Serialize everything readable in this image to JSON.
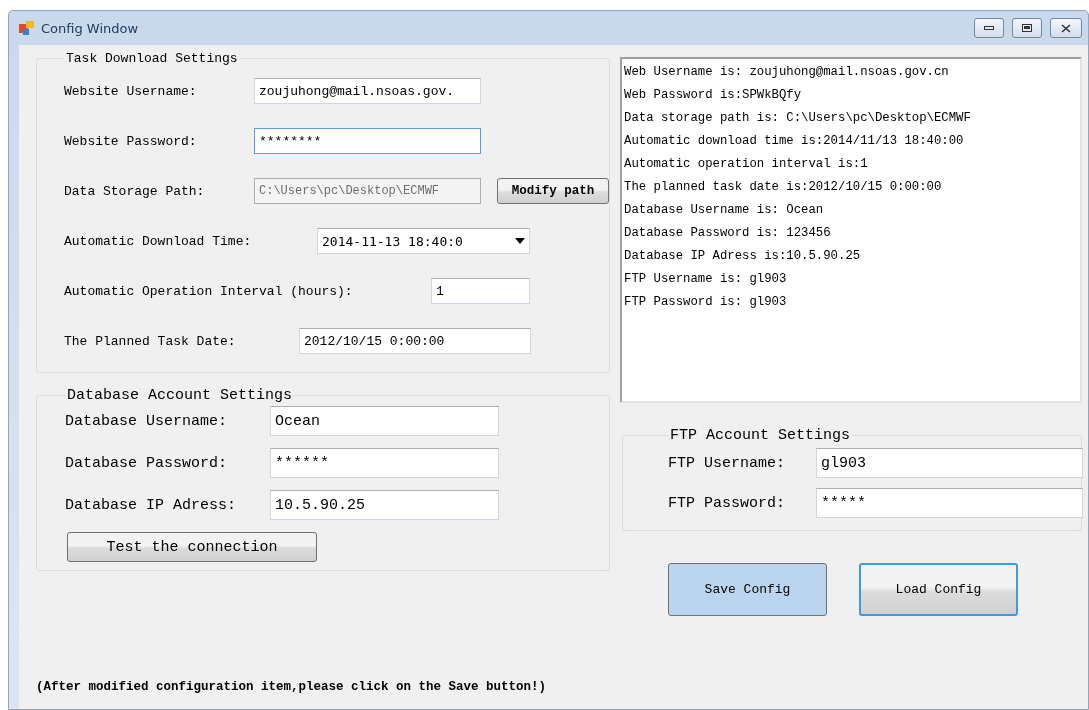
{
  "window": {
    "title": "Config Window"
  },
  "task_settings": {
    "title": "Task Download Settings",
    "fields": [
      {
        "kind": "text",
        "label": "Website Username:",
        "value": "zoujuhong@mail.nsoas.gov.",
        "focused": false
      },
      {
        "kind": "text",
        "label": "Website Password:",
        "value": "********",
        "focused": true
      },
      {
        "kind": "path",
        "label": "Data Storage Path:",
        "value": "C:\\Users\\pc\\Desktop\\ECMWF",
        "disabled": true,
        "button": "Modify path",
        "focused": false
      },
      {
        "kind": "datetime",
        "label": "Automatic Download Time:",
        "value": "2014-11-13 18:40:0",
        "focused": false
      },
      {
        "kind": "text",
        "label": "Automatic Operation Interval (hours):",
        "value": "1",
        "focused": false
      },
      {
        "kind": "text",
        "label": "The Planned Task Date:",
        "value": "2012/10/15 0:00:00",
        "focused": false
      }
    ]
  },
  "log_lines": [
    "Web Username is: zoujuhong@mail.nsoas.gov.cn",
    "Web Password is:SPWkBQfy",
    "Data storage path is: C:\\Users\\pc\\Desktop\\ECMWF",
    "Automatic download time is:2014/11/13 18:40:00",
    "Automatic operation interval is:1",
    "The planned task date is:2012/10/15 0:00:00",
    "Database Username is: Ocean",
    "Database Password is: 123456",
    "Database IP Adress is:10.5.90.25",
    "FTP Username is: gl903",
    "FTP Password is: gl903"
  ],
  "database_settings": {
    "title": "Database Account Settings",
    "fields": [
      {
        "label": "Database Username:",
        "value": "Ocean"
      },
      {
        "label": "Database Password:",
        "value": "******"
      },
      {
        "label": "Database IP Adress:",
        "value": "10.5.90.25"
      }
    ],
    "button": "Test the connection"
  },
  "ftp_settings": {
    "title": "FTP Account Settings",
    "fields": [
      {
        "label": "FTP Username:",
        "value": "gl903"
      },
      {
        "label": "FTP Password:",
        "value": "*****"
      }
    ]
  },
  "buttons": [
    {
      "label": "Save Config",
      "hovered": true,
      "focused": false
    },
    {
      "label": "Load Config",
      "hovered": false,
      "focused": true
    }
  ],
  "footer_note": "(After modified configuration item,please click on the Save button!)"
}
